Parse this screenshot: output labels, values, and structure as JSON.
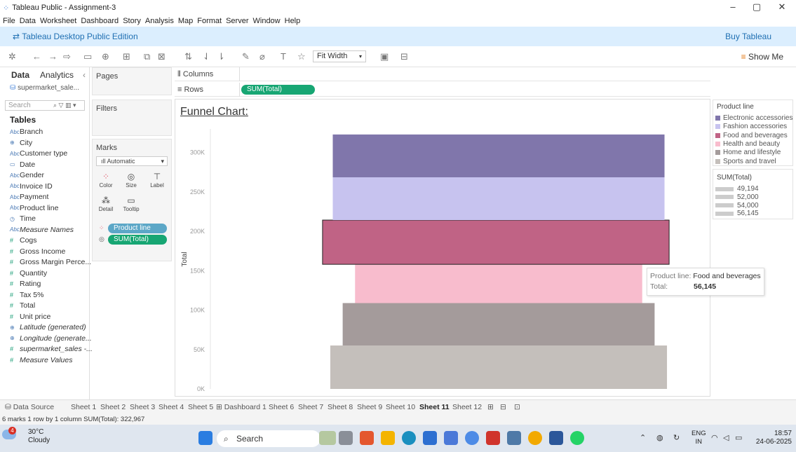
{
  "window": {
    "title": "Tableau Public - Assignment-3",
    "minimize": "–",
    "restore": "▢",
    "close": "✕"
  },
  "menu": [
    "File",
    "Data",
    "Worksheet",
    "Dashboard",
    "Story",
    "Analysis",
    "Map",
    "Format",
    "Server",
    "Window",
    "Help"
  ],
  "edition": {
    "label": "Tableau Desktop Public Edition",
    "buy": "Buy Tableau"
  },
  "toolbar": {
    "fit": "Fit Width",
    "show_me": "Show Me"
  },
  "datapane": {
    "tab_data": "Data",
    "tab_analytics": "Analytics",
    "datasource": "supermarket_sale...",
    "search_placeholder": "Search",
    "tables_heading": "Tables",
    "fields": [
      {
        "name": "Branch",
        "type": "Abc",
        "italic": false
      },
      {
        "name": "City",
        "type": "geo",
        "italic": false
      },
      {
        "name": "Customer type",
        "type": "Abc",
        "italic": false
      },
      {
        "name": "Date",
        "type": "date",
        "italic": false
      },
      {
        "name": "Gender",
        "type": "Abc",
        "italic": false
      },
      {
        "name": "Invoice ID",
        "type": "Abc",
        "italic": false
      },
      {
        "name": "Payment",
        "type": "Abc",
        "italic": false
      },
      {
        "name": "Product line",
        "type": "Abc",
        "italic": false
      },
      {
        "name": "Time",
        "type": "time",
        "italic": false
      },
      {
        "name": "Measure Names",
        "type": "Abc",
        "italic": true
      },
      {
        "name": "Cogs",
        "type": "#",
        "italic": false
      },
      {
        "name": "Gross Income",
        "type": "#",
        "italic": false
      },
      {
        "name": "Gross Margin Perce...",
        "type": "#",
        "italic": false
      },
      {
        "name": "Quantity",
        "type": "#",
        "italic": false
      },
      {
        "name": "Rating",
        "type": "#",
        "italic": false
      },
      {
        "name": "Tax 5%",
        "type": "#",
        "italic": false
      },
      {
        "name": "Total",
        "type": "#",
        "italic": false
      },
      {
        "name": "Unit price",
        "type": "#",
        "italic": false
      },
      {
        "name": "Latitude (generated)",
        "type": "geo",
        "italic": true
      },
      {
        "name": "Longitude (generate...",
        "type": "geo",
        "italic": true
      },
      {
        "name": "supermarket_sales -...",
        "type": "#",
        "italic": true
      },
      {
        "name": "Measure Values",
        "type": "#",
        "italic": true
      }
    ]
  },
  "cards": {
    "pages": "Pages",
    "filters": "Filters",
    "marks": "Marks",
    "marks_type": "Automatic",
    "mark_buttons": [
      "Color",
      "Size",
      "Label",
      "Detail",
      "Tooltip"
    ],
    "pill_color": "Product line",
    "pill_size": "SUM(Total)"
  },
  "shelves": {
    "columns": "Columns",
    "rows": "Rows",
    "rows_pill": "SUM(Total)"
  },
  "chart_data": {
    "type": "bar",
    "title": "Funnel Chart:",
    "ylabel": "Total",
    "ylim": [
      0,
      330000
    ],
    "ticks": [
      "0K",
      "50K",
      "100K",
      "150K",
      "200K",
      "250K",
      "300K"
    ],
    "tick_values": [
      0,
      50000,
      100000,
      150000,
      200000,
      250000,
      300000
    ],
    "stacking": "stacked",
    "segments": [
      {
        "name": "Sports and travel",
        "value": 55123,
        "color": "#c4bfbb",
        "width_pct": 0.68
      },
      {
        "name": "Home and lifestyle",
        "value": 53862,
        "color": "#a49b9b",
        "width_pct": 0.63
      },
      {
        "name": "Health and beauty",
        "value": 49194,
        "color": "#f8bccd",
        "width_pct": 0.58
      },
      {
        "name": "Food and beverages",
        "value": 56145,
        "color": "#c06385",
        "width_pct": 0.7,
        "highlight": true
      },
      {
        "name": "Fashion accessories",
        "value": 54306,
        "color": "#c7c3ef",
        "width_pct": 0.67
      },
      {
        "name": "Electronic accessories",
        "value": 54338,
        "color": "#8076ab",
        "width_pct": 0.67
      }
    ]
  },
  "legend": {
    "title": "Product line",
    "items": [
      {
        "label": "Electronic accessories",
        "color": "#8076ab"
      },
      {
        "label": "Fashion accessories",
        "color": "#c7c3ef"
      },
      {
        "label": "Food and beverages",
        "color": "#c06385"
      },
      {
        "label": "Health and beauty",
        "color": "#f8bccd"
      },
      {
        "label": "Home and lifestyle",
        "color": "#a49b9b"
      },
      {
        "label": "Sports and travel",
        "color": "#c4bfbb"
      }
    ],
    "size_title": "SUM(Total)",
    "size_items": [
      "49,194",
      "52,000",
      "54,000",
      "56,145"
    ]
  },
  "tooltip": {
    "k1": "Product line:",
    "v1": "Food and beverages",
    "k2": "Total:",
    "v2": "56,145"
  },
  "sheets": {
    "datasource": "Data Source",
    "tabs": [
      "Sheet 1",
      "Sheet 2",
      "Sheet 3",
      "Sheet 4",
      "Sheet 5",
      "Dashboard 1",
      "Sheet 6",
      "Sheet 7",
      "Sheet 8",
      "Sheet 9",
      "Sheet 10",
      "Sheet 11",
      "Sheet 12"
    ],
    "active": "Sheet 11"
  },
  "status": "6 marks   1 row by 1 column   SUM(Total): 322,967",
  "taskbar": {
    "temp": "30°C",
    "weather": "Cloudy",
    "badge": "4",
    "search": "Search",
    "lang1": "ENG",
    "lang2": "IN",
    "time": "18:57",
    "date": "24-06-2025"
  }
}
